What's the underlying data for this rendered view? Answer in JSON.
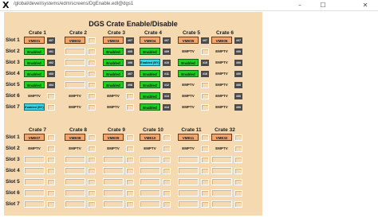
{
  "window": {
    "title": "/global/devel/systems/edm/screens/DgEnable.edl@dgs1",
    "minimize_glyph": "–",
    "maximize_glyph": "☐",
    "close_glyph": "✕"
  },
  "panel": {
    "title": "DGS Crate Enable/Disable"
  },
  "slot_labels": [
    "Slot 1",
    "Slot 2",
    "Slot 3",
    "Slot 4",
    "Slot 5",
    "Slot 6",
    "Slot 7"
  ],
  "top_group": {
    "crates": [
      {
        "name": "Crate 1",
        "cells": [
          {
            "kind": "vme",
            "text": "VME01",
            "sq": "#07"
          },
          {
            "kind": "enabled",
            "text": "Enabled",
            "sq": "#01"
          },
          {
            "kind": "enabled",
            "text": "Enabled",
            "sq": "#02"
          },
          {
            "kind": "enabled",
            "text": "Enabled",
            "sq": "#03"
          },
          {
            "kind": "enabled",
            "text": "Enabled",
            "sq": "#04"
          },
          {
            "kind": "emptv",
            "text": "EMPTV",
            "sq": ""
          },
          {
            "kind": "bypass",
            "text": "Enabled (BY)",
            "sq": ""
          }
        ]
      },
      {
        "name": "Crate 2",
        "cells": [
          {
            "kind": "vme",
            "text": "VME02",
            "sq": ""
          },
          {
            "kind": "empty",
            "text": "",
            "sq": ""
          },
          {
            "kind": "empty",
            "text": "",
            "sq": ""
          },
          {
            "kind": "empty",
            "text": "",
            "sq": ""
          },
          {
            "kind": "empty",
            "text": "",
            "sq": ""
          },
          {
            "kind": "emptv",
            "text": "EMPTV",
            "sq": ""
          },
          {
            "kind": "emptv",
            "text": "EMPTV",
            "sq": ""
          }
        ]
      },
      {
        "name": "Crate 3",
        "cells": [
          {
            "kind": "vme",
            "text": "VME03",
            "sq": "#07"
          },
          {
            "kind": "enabled",
            "text": "Enabled",
            "sq": "#05"
          },
          {
            "kind": "enabled",
            "text": "Enabled",
            "sq": "#06"
          },
          {
            "kind": "enabled",
            "text": "Enabled",
            "sq": "#07"
          },
          {
            "kind": "enabled",
            "text": "Enabled",
            "sq": "#08"
          },
          {
            "kind": "emptv",
            "text": "EMPTV",
            "sq": ""
          },
          {
            "kind": "emptv",
            "text": "EMPTV",
            "sq": ""
          }
        ]
      },
      {
        "name": "Crate 4",
        "cells": [
          {
            "kind": "vme",
            "text": "VME04",
            "sq": "#07"
          },
          {
            "kind": "enabled",
            "text": "Enabled",
            "sq": "#09"
          },
          {
            "kind": "bypass",
            "text": "Enabled (BY)",
            "sq": "#10"
          },
          {
            "kind": "enabled",
            "text": "Enabled",
            "sq": "#11"
          },
          {
            "kind": "enabled",
            "text": "Enabled",
            "sq": "#12"
          },
          {
            "kind": "enabled",
            "text": "Enabled",
            "sq": "#13"
          },
          {
            "kind": "enabled",
            "text": "Enabled",
            "sq": "#14"
          }
        ]
      },
      {
        "name": "Crate 5",
        "cells": [
          {
            "kind": "vme",
            "text": "VME05",
            "sq": "#07"
          },
          {
            "kind": "emptv",
            "text": "EMPTV",
            "sq": ""
          },
          {
            "kind": "enabled",
            "text": "Enabled",
            "sq": "#15"
          },
          {
            "kind": "enabled",
            "text": "Enabled",
            "sq": "#16"
          },
          {
            "kind": "emptv",
            "text": "EMPTV",
            "sq": ""
          },
          {
            "kind": "emptv",
            "text": "EMPTV",
            "sq": ""
          },
          {
            "kind": "emptv",
            "text": "EMPTV",
            "sq": ""
          }
        ]
      },
      {
        "name": "Crate 6",
        "cells": [
          {
            "kind": "vme",
            "text": "VME06",
            "sq": "#07"
          },
          {
            "kind": "emptv",
            "text": "EMPTV",
            "sq": "#00"
          },
          {
            "kind": "emptv",
            "text": "EMPTV",
            "sq": "#00"
          },
          {
            "kind": "emptv",
            "text": "EMPTV",
            "sq": "#00"
          },
          {
            "kind": "emptv",
            "text": "EMPTV",
            "sq": "#00"
          },
          {
            "kind": "emptv",
            "text": "EMPTV",
            "sq": "#00"
          },
          {
            "kind": "emptv",
            "text": "EMPTV",
            "sq": "#00"
          }
        ]
      }
    ]
  },
  "bottom_group": {
    "crates": [
      {
        "name": "Crate 7",
        "cells": [
          {
            "kind": "vme",
            "text": "VME07",
            "sq": ""
          },
          {
            "kind": "emptv",
            "text": "EMPTV",
            "sq": ""
          },
          {
            "kind": "empty",
            "text": "",
            "sq": ""
          },
          {
            "kind": "empty",
            "text": "",
            "sq": ""
          },
          {
            "kind": "empty",
            "text": "",
            "sq": ""
          },
          {
            "kind": "empty",
            "text": "",
            "sq": ""
          },
          {
            "kind": "empty",
            "text": "",
            "sq": ""
          }
        ]
      },
      {
        "name": "Crate 8",
        "cells": [
          {
            "kind": "vme",
            "text": "VME08",
            "sq": ""
          },
          {
            "kind": "emptv",
            "text": "EMPTV",
            "sq": ""
          },
          {
            "kind": "empty",
            "text": "",
            "sq": ""
          },
          {
            "kind": "empty",
            "text": "",
            "sq": ""
          },
          {
            "kind": "empty",
            "text": "",
            "sq": ""
          },
          {
            "kind": "empty",
            "text": "",
            "sq": ""
          },
          {
            "kind": "empty",
            "text": "",
            "sq": ""
          }
        ]
      },
      {
        "name": "Crate 9",
        "cells": [
          {
            "kind": "vme",
            "text": "VME09",
            "sq": ""
          },
          {
            "kind": "emptv",
            "text": "EMPTV",
            "sq": ""
          },
          {
            "kind": "empty",
            "text": "",
            "sq": ""
          },
          {
            "kind": "empty",
            "text": "",
            "sq": ""
          },
          {
            "kind": "empty",
            "text": "",
            "sq": ""
          },
          {
            "kind": "empty",
            "text": "",
            "sq": ""
          },
          {
            "kind": "empty",
            "text": "",
            "sq": ""
          }
        ]
      },
      {
        "name": "Crate 10",
        "cells": [
          {
            "kind": "vme",
            "text": "VME10",
            "sq": ""
          },
          {
            "kind": "emptv",
            "text": "EMPTV",
            "sq": ""
          },
          {
            "kind": "empty",
            "text": "",
            "sq": ""
          },
          {
            "kind": "empty",
            "text": "",
            "sq": ""
          },
          {
            "kind": "empty",
            "text": "",
            "sq": ""
          },
          {
            "kind": "empty",
            "text": "",
            "sq": ""
          },
          {
            "kind": "empty",
            "text": "",
            "sq": ""
          }
        ]
      },
      {
        "name": "Crate 11",
        "cells": [
          {
            "kind": "vme",
            "text": "VME11",
            "sq": ""
          },
          {
            "kind": "emptv",
            "text": "EMPTV",
            "sq": ""
          },
          {
            "kind": "empty",
            "text": "",
            "sq": ""
          },
          {
            "kind": "empty",
            "text": "",
            "sq": ""
          },
          {
            "kind": "empty",
            "text": "",
            "sq": ""
          },
          {
            "kind": "empty",
            "text": "",
            "sq": ""
          },
          {
            "kind": "empty",
            "text": "",
            "sq": ""
          }
        ]
      },
      {
        "name": "Crate 32",
        "cells": [
          {
            "kind": "vme",
            "text": "VME32",
            "sq": ""
          },
          {
            "kind": "emptv",
            "text": "EMPTV",
            "sq": ""
          },
          {
            "kind": "empty",
            "text": "",
            "sq": ""
          },
          {
            "kind": "empty",
            "text": "",
            "sq": ""
          },
          {
            "kind": "empty",
            "text": "",
            "sq": ""
          },
          {
            "kind": "empty",
            "text": "",
            "sq": ""
          },
          {
            "kind": "empty",
            "text": "",
            "sq": ""
          }
        ]
      }
    ]
  },
  "colors": {
    "panel_bg": "#f5d9b0",
    "vme": "#f4a46a",
    "enabled": "#18d418",
    "bypass": "#33d8e8",
    "indicator": "#4a4a4a"
  }
}
